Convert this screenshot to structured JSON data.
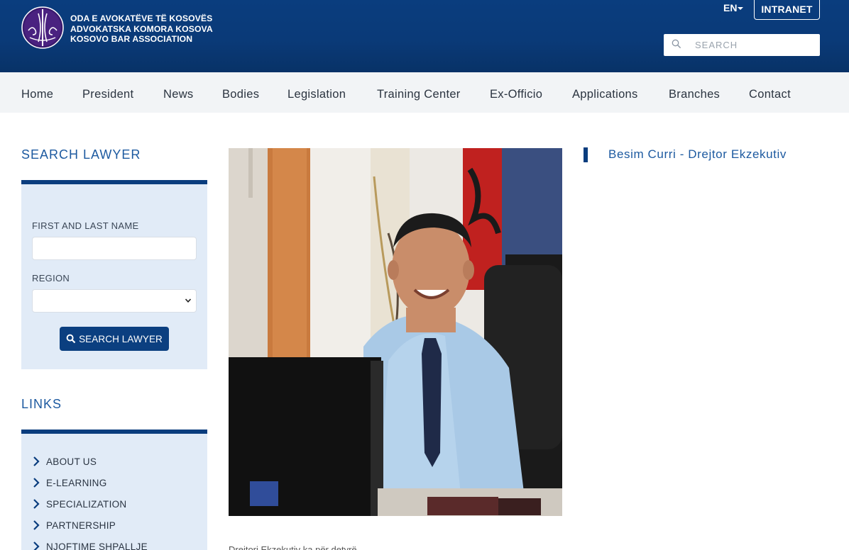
{
  "header": {
    "org_lines": [
      "ODA E AVOKATËVE TË KOSOVËS",
      "ADVOKATSKA KOMORA KOSOVA",
      "KOSOVO BAR ASSOCIATION"
    ],
    "language": "EN",
    "intranet_label": "INTRANET",
    "search_placeholder": "SEARCH",
    "search_icon": "search-icon",
    "colors": {
      "header_bg": "#0a3d7e",
      "accent": "#1d5aa0",
      "button": "#0b3f80",
      "panel_bg": "#e1ebf7"
    }
  },
  "nav": {
    "items": [
      "Home",
      "President",
      "News",
      "Bodies",
      "Legislation",
      "Training Center",
      "Ex-Officio",
      "Applications",
      "Branches",
      "Contact"
    ]
  },
  "search_lawyer": {
    "title": "SEARCH LAWYER",
    "name_label": "FIRST AND LAST NAME",
    "name_value": "",
    "region_label": "REGION",
    "region_selected": "",
    "button_label": "SEARCH LAWYER"
  },
  "links": {
    "title": "LINKS",
    "items": [
      "ABOUT US",
      "E-LEARNING",
      "SPECIALIZATION",
      "PARTNERSHIP",
      "NJOFTIME SHPALLJE"
    ]
  },
  "profile": {
    "caption": "Besim Curri - Drejtor Ekzekutiv",
    "text_excerpt": "Drejtori Ekzekutiv ka për detyrë..."
  }
}
